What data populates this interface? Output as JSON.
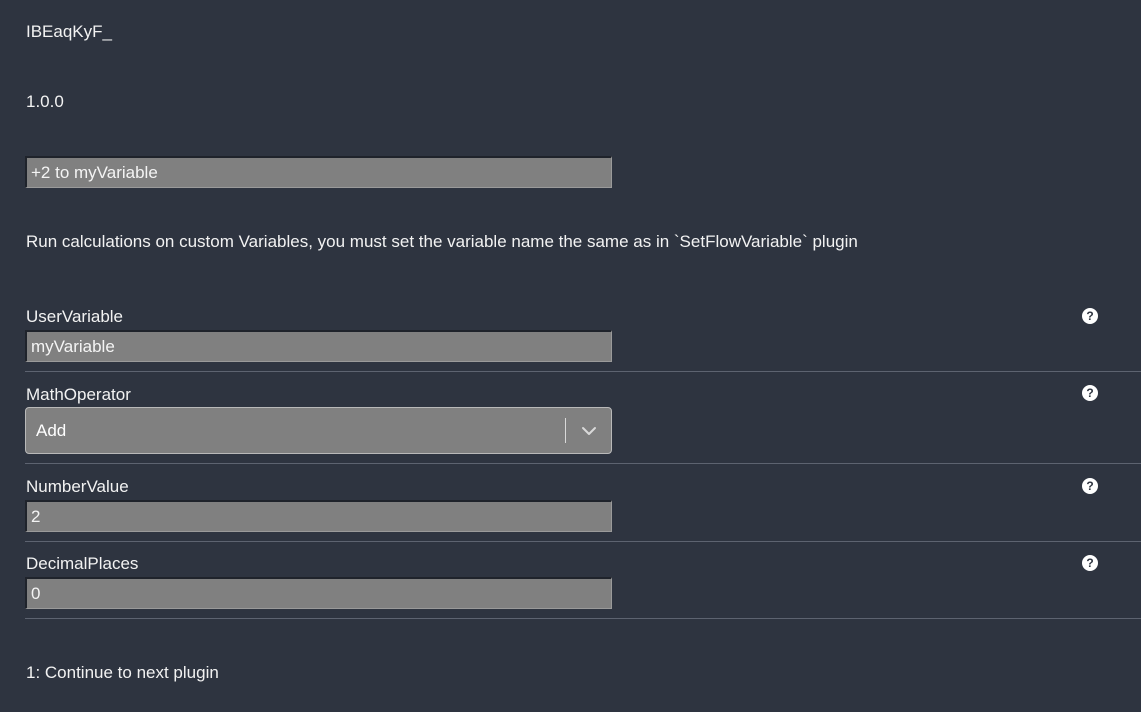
{
  "plugin": {
    "id": "IBEaqKyF_",
    "version": "1.0.0",
    "name": "+2 to myVariable",
    "description": "Run calculations on custom Variables, you must set the variable name the same as in `SetFlowVariable` plugin"
  },
  "fields": {
    "user_variable": {
      "label": "UserVariable",
      "value": "myVariable"
    },
    "math_operator": {
      "label": "MathOperator",
      "value": "Add"
    },
    "number_value": {
      "label": "NumberValue",
      "value": "2"
    },
    "decimal_places": {
      "label": "DecimalPlaces",
      "value": "0"
    }
  },
  "help_icon": {
    "icon": "question-circle-icon",
    "glyph": "?"
  },
  "outputs": {
    "first": "1: Continue to next plugin"
  },
  "colors": {
    "background": "#2e3440",
    "input_background": "#808080",
    "text": "#f2f2f2"
  }
}
